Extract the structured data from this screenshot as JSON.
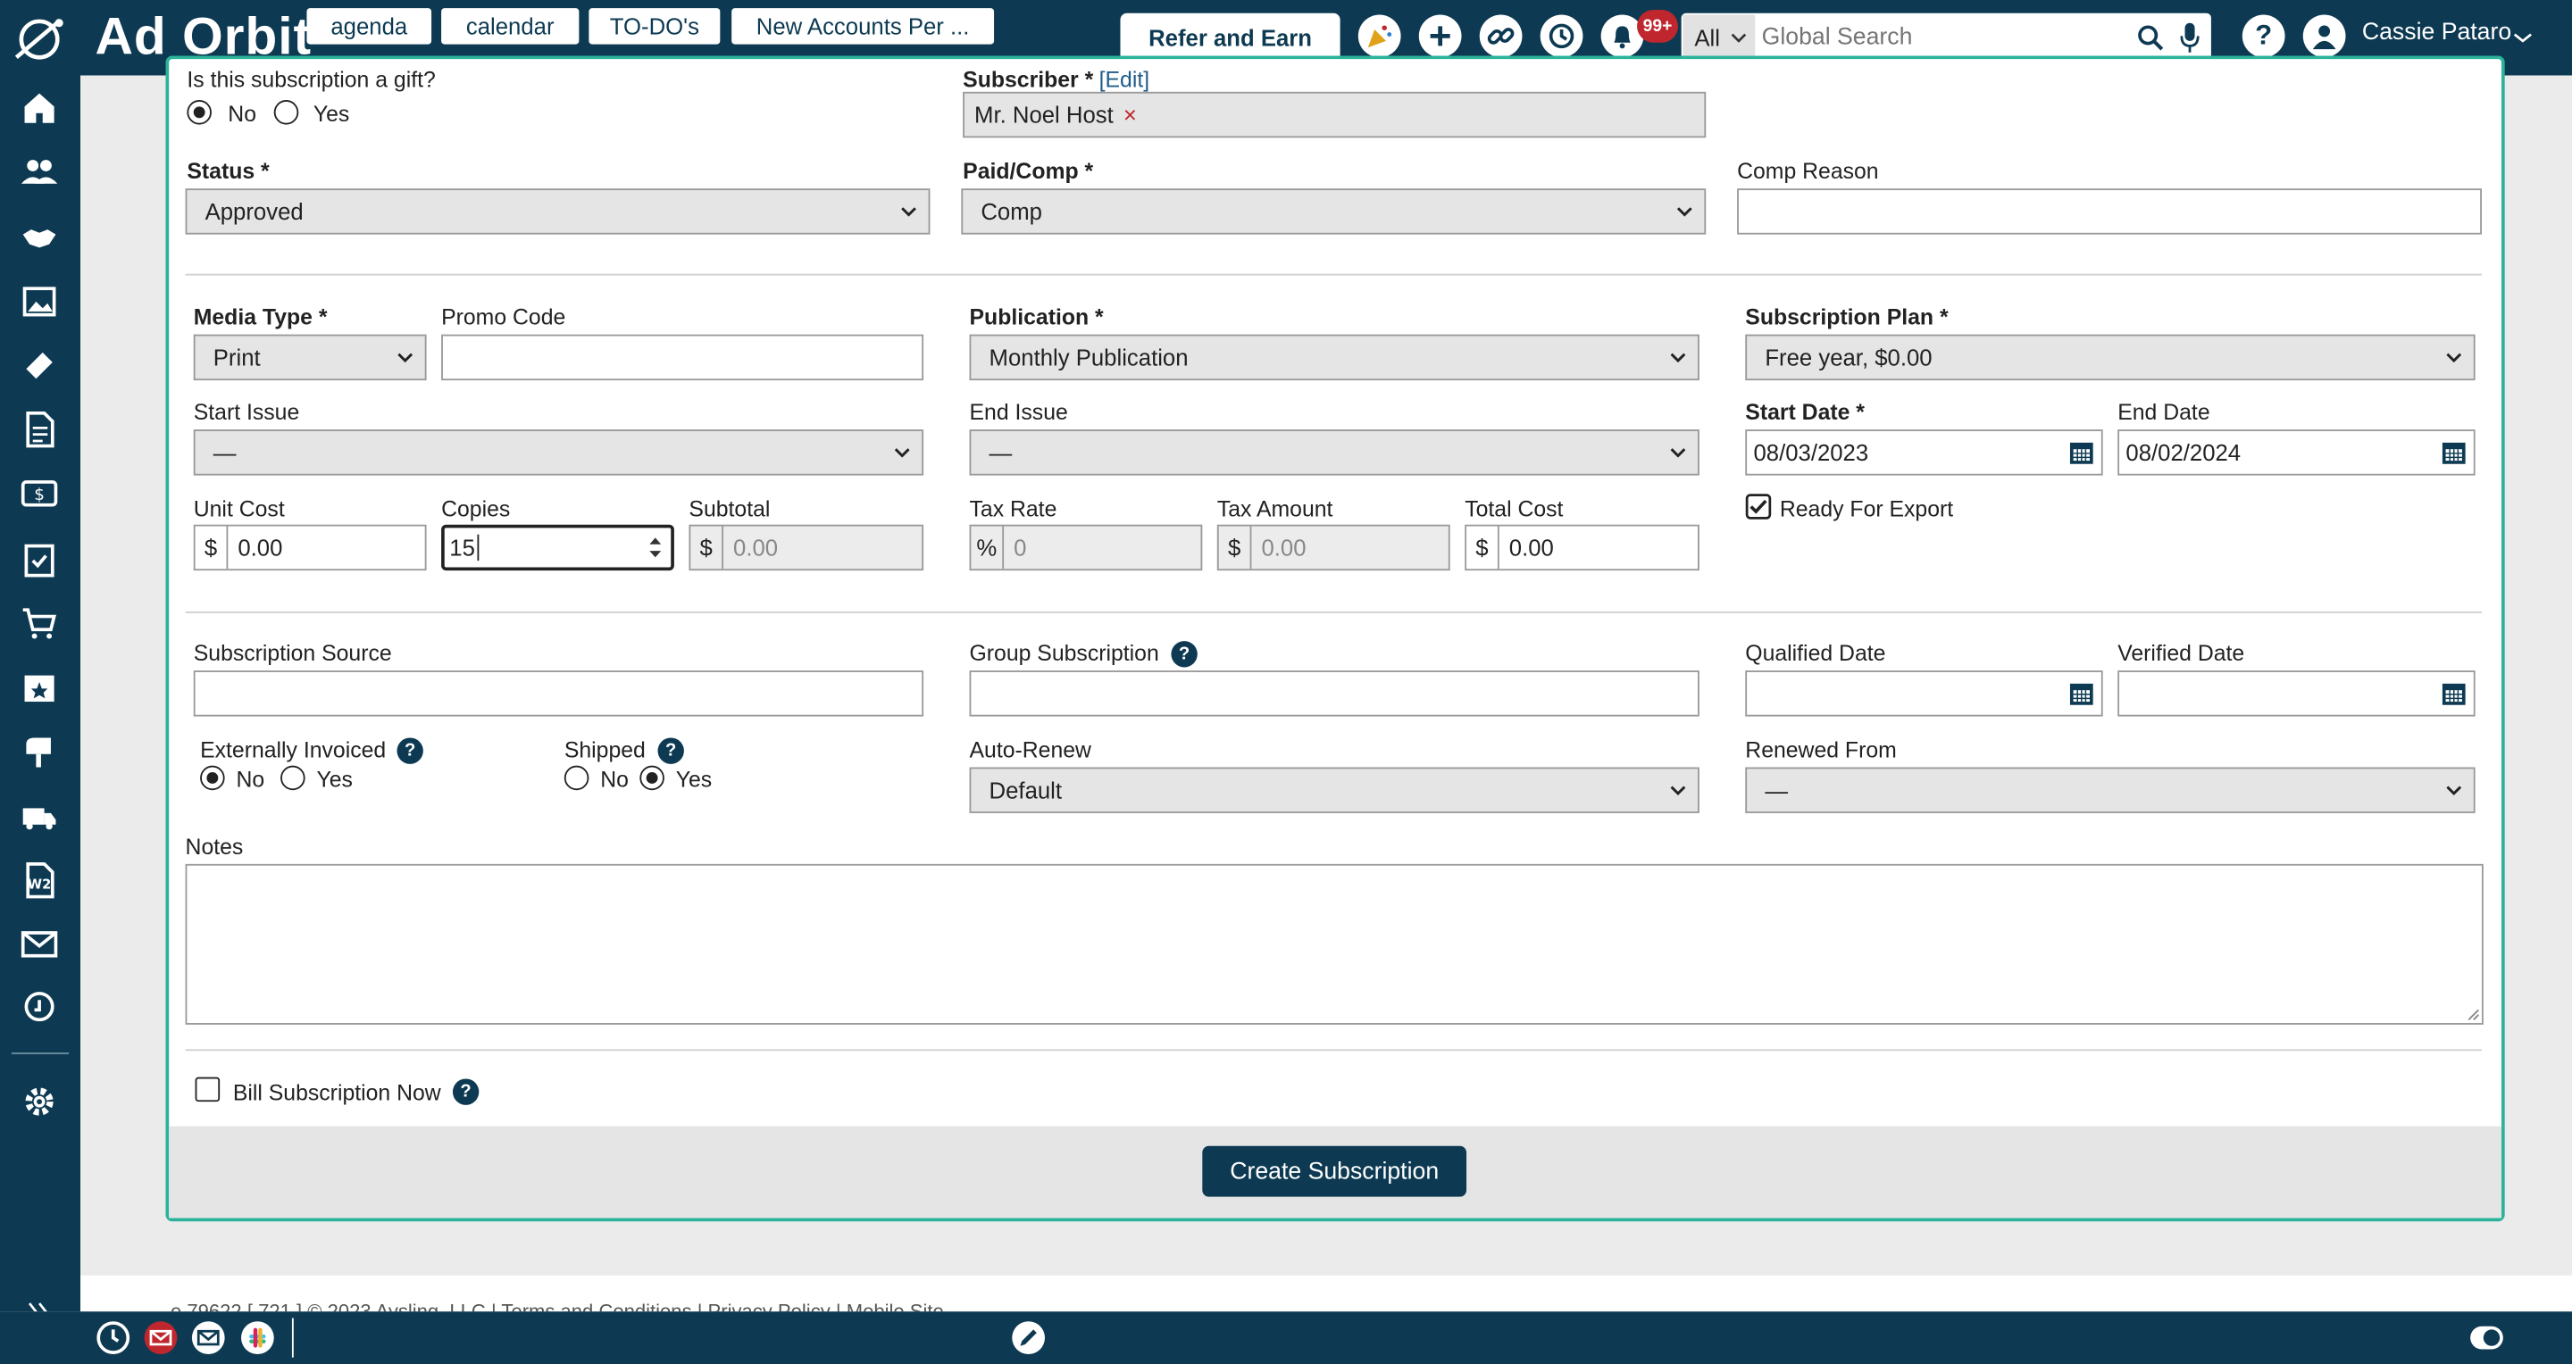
{
  "header": {
    "logo": "Ad Orbit",
    "refer_label": "Refer and Earn",
    "notification_badge": "99+",
    "search_scope": "All",
    "search_placeholder": "Global Search",
    "help_label": "?",
    "user_name": "Cassie Pataro"
  },
  "form": {
    "gift": {
      "label": "Is this subscription a gift?",
      "no": "No",
      "yes": "Yes",
      "selected": "No"
    },
    "subscriber": {
      "label": "Subscriber *",
      "edit": "[Edit]",
      "value": "Mr. Noel Host",
      "remove": "×"
    },
    "status": {
      "label": "Status *",
      "value": "Approved"
    },
    "paid_comp": {
      "label": "Paid/Comp *",
      "value": "Comp"
    },
    "comp_reason": {
      "label": "Comp Reason",
      "value": ""
    },
    "media_type": {
      "label": "Media Type *",
      "value": "Print"
    },
    "promo_code": {
      "label": "Promo Code",
      "value": ""
    },
    "publication": {
      "label": "Publication *",
      "value": "Monthly Publication"
    },
    "plan": {
      "label": "Subscription Plan *",
      "value": "Free year, $0.00"
    },
    "start_issue": {
      "label": "Start Issue",
      "value": "—"
    },
    "end_issue": {
      "label": "End Issue",
      "value": "—"
    },
    "start_date": {
      "label": "Start Date *",
      "value": "08/03/2023"
    },
    "end_date": {
      "label": "End Date",
      "value": "08/02/2024"
    },
    "unit_cost": {
      "label": "Unit Cost",
      "prefix": "$",
      "value": "0.00"
    },
    "copies": {
      "label": "Copies",
      "value": "15"
    },
    "subtotal": {
      "label": "Subtotal",
      "prefix": "$",
      "placeholder": "0.00"
    },
    "tax_rate": {
      "label": "Tax Rate",
      "prefix": "%",
      "placeholder": "0"
    },
    "tax_amount": {
      "label": "Tax Amount",
      "prefix": "$",
      "placeholder": "0.00"
    },
    "total_cost": {
      "label": "Total Cost",
      "prefix": "$",
      "value": "0.00"
    },
    "ready_export": {
      "label": "Ready For Export",
      "checked": true
    },
    "source": {
      "label": "Subscription Source",
      "value": ""
    },
    "group": {
      "label": "Group Subscription",
      "value": ""
    },
    "qualified_date": {
      "label": "Qualified Date",
      "value": ""
    },
    "verified_date": {
      "label": "Verified Date",
      "value": ""
    },
    "ext_invoiced": {
      "label": "Externally Invoiced",
      "no": "No",
      "yes": "Yes",
      "selected": "No"
    },
    "shipped": {
      "label": "Shipped",
      "no": "No",
      "yes": "Yes",
      "selected": "Yes"
    },
    "auto_renew": {
      "label": "Auto-Renew",
      "value": "Default"
    },
    "renewed_from": {
      "label": "Renewed From",
      "value": "—"
    },
    "notes": {
      "label": "Notes",
      "value": ""
    },
    "bill_now": {
      "label": "Bill Subscription Now",
      "checked": false
    },
    "submit_label": "Create Subscription"
  },
  "footer": {
    "text": "…e 79622 [ 721 ] © 2023 Aysling, LLC | Terms and Conditions | Privacy Policy | Mobile Site"
  },
  "taskbar": {
    "items": [
      "agenda",
      "calendar",
      "TO-DO's",
      "New Accounts Per ..."
    ]
  },
  "colors": {
    "primary": "#0d3a52",
    "accent": "#2bb39a",
    "badge": "#c0262d"
  }
}
